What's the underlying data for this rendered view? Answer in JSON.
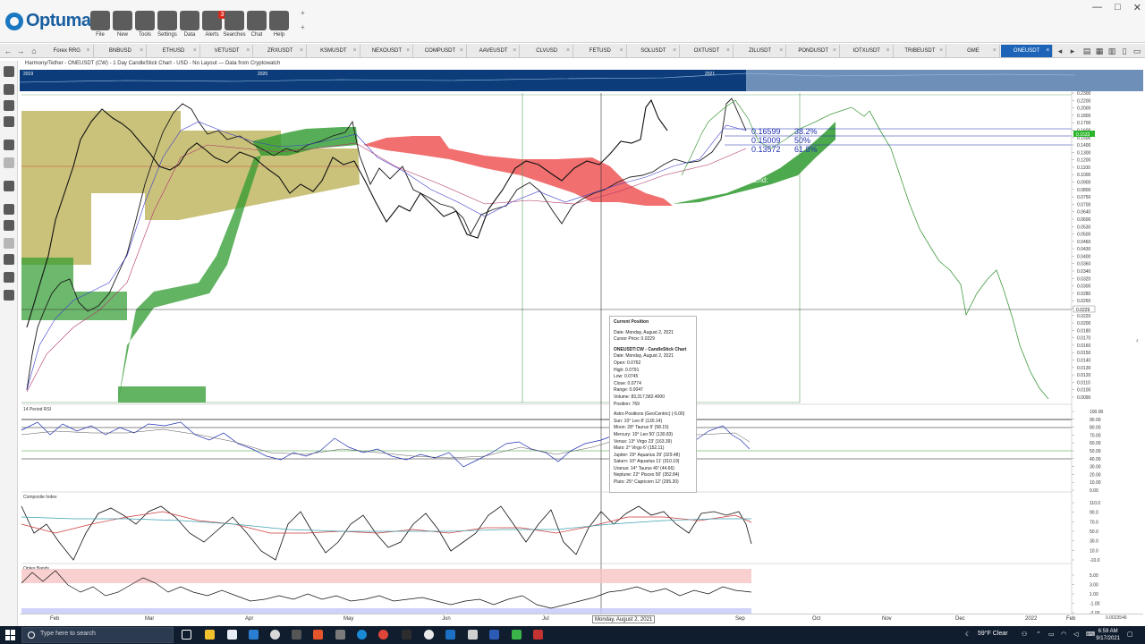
{
  "app": {
    "name": "Optuma"
  },
  "ribbon": [
    {
      "key": "file",
      "label": "File",
      "icon": "folder-icon"
    },
    {
      "key": "new",
      "label": "New",
      "icon": "new-document-icon"
    },
    {
      "key": "tools",
      "label": "Tools",
      "icon": "tools-icon"
    },
    {
      "key": "settings",
      "label": "Settings",
      "icon": "gear-icon"
    },
    {
      "key": "data",
      "label": "Data",
      "icon": "binary-data-icon"
    },
    {
      "key": "alerts",
      "label": "Alerts",
      "icon": "alarm-clock-icon",
      "badge": "3"
    },
    {
      "key": "searches",
      "label": "Searches",
      "icon": "search-icon"
    },
    {
      "key": "chat",
      "label": "Chat",
      "icon": "chat-icon"
    },
    {
      "key": "help",
      "label": "Help",
      "icon": "help-icon"
    }
  ],
  "tabs": [
    "Forex RRG",
    "BNBUSD",
    "ETHUSD",
    "VETUSDT",
    "ZRXUSDT",
    "KSMUSDT",
    "NEXOUSDT",
    "COMPUSDT",
    "AAVEUSDT",
    "CLVUSD",
    "FETUSD",
    "SOLUSDT",
    "OXTUSDT",
    "ZILUSDT",
    "PONDUSDT",
    "IOTXUSDT",
    "TRIBEUSDT",
    "GME",
    "ONEUSDT"
  ],
  "active_tab": "ONEUSDT",
  "chart": {
    "title": "Harmony/Tether - ONEUSDT (CW) - 1 Day CandleStick Chart - USD - No Layout — Data from Cryptowatch",
    "overview_years": [
      "2019",
      "2020",
      "2021"
    ],
    "price_ticks": [
      "0.2300",
      "0.2200",
      "0.2000",
      "0.1800",
      "0.1700",
      "0.1600",
      "0.1500",
      "0.1400",
      "0.1300",
      "0.1200",
      "0.1100",
      "0.1000",
      "0.0900",
      "0.0800",
      "0.0750",
      "0.0700",
      "0.0640",
      "0.0600",
      "0.0530",
      "0.0500",
      "0.0460",
      "0.0430",
      "0.0400",
      "0.0360",
      "0.0340",
      "0.0320",
      "0.0300",
      "0.0280",
      "0.0260",
      "0.0240",
      "0.0220",
      "0.0200",
      "0.0180",
      "0.0170",
      "0.0160",
      "0.0150",
      "0.0140",
      "0.0130",
      "0.0120",
      "0.0110",
      "0.0100",
      "0.0090"
    ],
    "last_price_badge": "0.1533",
    "cursor_price_badge": "0.0229",
    "fib_levels": [
      {
        "price": "0.16599",
        "pct": "38.2%"
      },
      {
        "price": "0.15009",
        "pct": "50%"
      },
      {
        "price": "0.13572",
        "pct": "61.8%"
      }
    ],
    "end_label": "End:",
    "rsi": {
      "title": "14 Period RSI",
      "ticks": [
        "100.00",
        "90.00",
        "80.00",
        "70.00",
        "60.00",
        "50.00",
        "40.00",
        "30.00",
        "20.00",
        "10.00",
        "0.00"
      ]
    },
    "composite": {
      "title": "Composite Index",
      "ticks": [
        "110.0",
        "90.0",
        "70.0",
        "50.0",
        "30.0",
        "10.0",
        "-10.0"
      ]
    },
    "optex": {
      "title": "Optex Bands",
      "ticks": [
        "5.00",
        "3.00",
        "1.00",
        "-1.00",
        "-3.00"
      ]
    },
    "x_labels": [
      "Feb",
      "Mar",
      "Apr",
      "May",
      "Jun",
      "Jul",
      "Aug",
      "Sep",
      "Oct",
      "Nov",
      "Dec",
      "2022",
      "Feb"
    ],
    "cursor_date": "Monday, August 2, 2021",
    "volume_corner": "0.0023546"
  },
  "tooltip": {
    "heading": "Current Position",
    "date": "Date: Monday, August 2, 2021",
    "cursor_price": "Cursor Price: 0.0229",
    "series_title": "ONEUSDT:CW - CandleStick Chart",
    "series_date": "Date: Monday, August 2, 2021",
    "open": "Open: 0.0762",
    "high": "High: 0.0791",
    "low": "Low: 0.0745",
    "close": "Close: 0.0774",
    "range": "Range: 0.0047",
    "volume": "Volume: 83,317,582.4000",
    "position": "Position: 769",
    "astro_title": "Astro Positions (GeoCentric) (-5.00)",
    "planets": [
      "Sun: 10° Leo 8' (130.14)",
      "Moon: 28° Taurus 9' (58.15)",
      "Mercury: 10° Leo 50' (130.83)",
      "Venus: 13° Virgo 23' (163.39)",
      "Mars: 2° Virgo 6' (152.11)",
      "Jupiter: 29° Aquarius 29' (329.48)",
      "Saturn: 10° Aquarius 11' (310.19)",
      "Uranus: 14° Taurus 40' (44.66)",
      "Neptune: 22° Pisces 50' (352.84)",
      "Pluto: 25° Capricorn 12' (295.20)"
    ]
  },
  "taskbar": {
    "search_placeholder": "Type here to search",
    "weather": "59°F  Clear",
    "time": "6:59 AM",
    "date": "9/17/2021"
  },
  "colors": {
    "cloud_bull": "#2e9a2e",
    "cloud_bear": "#ee4b4b",
    "tab_active": "#1d64b8",
    "fib": "#1f2fb0",
    "overview": "#0c3d7a"
  }
}
